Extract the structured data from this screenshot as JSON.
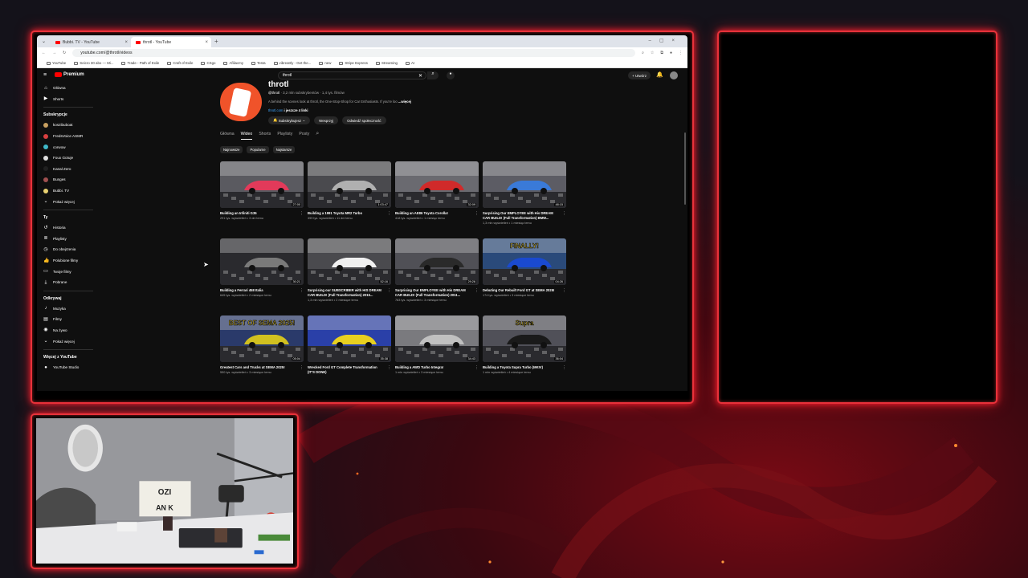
{
  "browser": {
    "tabs": [
      {
        "label": "Bubbi. TV - YouTube",
        "active": false
      },
      {
        "label": "throtl - YouTube",
        "active": true
      }
    ],
    "url": "youtube.com/@throtl/videos",
    "bookmarks": [
      "YouTube",
      "Seicro 30 abo — Mi...",
      "Trade - Path of Exile",
      "Craft of Exile",
      "CSgo",
      "Afiliacmy",
      "Testa",
      "vibreatrly - Get the...",
      "new",
      "Stripe Express",
      "Streaming",
      "AI"
    ]
  },
  "youtube": {
    "logo_label": "Premium",
    "search_value": "throtl",
    "create_label": "Utwórz",
    "sidebar": {
      "main": [
        {
          "label": "Główna",
          "icon": "home-icon"
        },
        {
          "label": "Shorts",
          "icon": "shorts-icon"
        }
      ],
      "subs_title": "Subskrypcje",
      "subs": [
        {
          "label": "koszibuboat",
          "color": "#c8a060"
        },
        {
          "label": "FredsVoice ASMR",
          "color": "#d94040"
        },
        {
          "label": "corwow",
          "color": "#3fb8c8"
        },
        {
          "label": "Foux Gotuje",
          "color": "#e0e0e0"
        },
        {
          "label": "Kanał Zero",
          "color": "#202020"
        },
        {
          "label": "Bunges",
          "color": "#a05050"
        },
        {
          "label": "Bubbi. TV",
          "color": "#e8d070"
        }
      ],
      "show_more": "Pokaż więcej",
      "you_title": "Ty",
      "you": [
        {
          "label": "Historia",
          "icon": "history-icon"
        },
        {
          "label": "Playlisty",
          "icon": "playlist-icon"
        },
        {
          "label": "Do obejrzenia",
          "icon": "watch-later-icon"
        },
        {
          "label": "Polubione filmy",
          "icon": "like-icon"
        },
        {
          "label": "Twoje filmy",
          "icon": "video-icon"
        },
        {
          "label": "Pobrane",
          "icon": "download-icon"
        }
      ],
      "explore_title": "Odkrywaj",
      "explore": [
        {
          "label": "Muzyka",
          "icon": "music-icon"
        },
        {
          "label": "Filmy",
          "icon": "movies-icon"
        },
        {
          "label": "Na żywo",
          "icon": "live-icon"
        },
        {
          "label": "Pokaż więcej",
          "icon": "chevron-down-icon"
        }
      ],
      "more_title": "Więcej z YouTube",
      "more": [
        {
          "label": "YouTube Studio",
          "icon": "studio-icon"
        }
      ]
    },
    "channel": {
      "name": "throtl",
      "handle": "@throtl",
      "meta": " · 3,2 mln subskrybentów · 1,4 tys. filmów",
      "desc": "A behind the scenes look at throtl, the One-Stop-Shop for Car Enthusiasts. If you're loo",
      "desc_more": "...więcej",
      "link": "throtl.com",
      "link_more": " i jeszcze 4 linki",
      "buttons": [
        "Subskrybujesz",
        "Wesprzyj",
        "Odwiedź społeczność"
      ],
      "tabs": [
        "Główna",
        "Wideo",
        "Shorts",
        "Playlisty",
        "Posty"
      ],
      "active_tab": "Wideo",
      "chips": [
        "Najnowsze",
        "Popularne",
        "Najstarsze"
      ]
    },
    "videos": [
      {
        "title": "Building an Infiniti G35",
        "meta": "291 tys. wyświetleń • 3 dni temu",
        "duration": "27:00",
        "bg": "#5a5a60",
        "car": "#e23a5a"
      },
      {
        "title": "Building a 1991 Toyota MR2 Turbo",
        "meta": "399 tys. wyświetleń • 11 dni temu",
        "duration": "1:03:47",
        "bg": "#4a4a4e",
        "car": "#b0b0b0"
      },
      {
        "title": "Building an AE86 Toyota Corolla!",
        "meta": "418 tys. wyświetleń • 1 miesiąc temu",
        "duration": "32:09",
        "bg": "#6a6a70",
        "car": "#d02a2a"
      },
      {
        "title": "Surprising Our EMPLOYEE with His DREAM CAR BUILD! (Full Transformation) BMW...",
        "meta": "1,3 mln wyświetleń • 1 miesiąc temu",
        "duration": "48:15",
        "bg": "#5c5c64",
        "car": "#3a7ad8"
      },
      {
        "title": "Building a Ferrari 458 Italia",
        "meta": "645 tys. wyświetleń • 2 miesiące temu",
        "duration": "30:21",
        "bg": "#2a2a2e",
        "car": "#7a7a7a"
      },
      {
        "title": "Surprising our SUBSCRIBER with HIS DREAM CAR BUILD! (Full Transformation) 2015...",
        "meta": "1,3 mln wyświetleń • 2 miesiące temu",
        "duration": "52:16",
        "bg": "#4a4a4e",
        "car": "#f0f0f0"
      },
      {
        "title": "Surprising Our EMPLOYEE with His DREAM CAR BUILD! (Full Transformation) 2011...",
        "meta": "783 tys. wyświetleń • 3 miesiące temu",
        "duration": "29:26",
        "bg": "#505056",
        "car": "#2a2a2a"
      },
      {
        "title": "Debuting Our Rebuilt Ford GT at SEMA 2025!",
        "meta": "174 tys. wyświetleń • 3 miesiące temu",
        "duration": "04:26",
        "bg": "#2a4a7a",
        "car": "#1a4ad0",
        "banner": "FINALLY!"
      },
      {
        "title": "Greatest Cars and Trucks at SEMA 2025!",
        "meta": "550 tys. wyświetleń • 3 miesiące temu",
        "duration": "05:04",
        "bg": "#2a3a6a",
        "car": "#d0c020",
        "banner": "BEST OF SEMA 2025!"
      },
      {
        "title": "Wrecked Ford GT Complete Transformation (IT'S DONE)",
        "meta": "",
        "duration": "35:38",
        "bg": "#2a40a8",
        "car": "#e8d020"
      },
      {
        "title": "Building a AWD Turbo Integra!",
        "meta": "1 mln wyświetleń • 3 miesiące temu",
        "duration": "34:43",
        "bg": "#7a7a7e",
        "car": "#c0c0c0"
      },
      {
        "title": "Building a Toyota Supra Turbo (MKIV)",
        "meta": "1 mln wyświetleń • 4 miesiące temu",
        "duration": "36:04",
        "bg": "#505058",
        "car": "#1a1a1a",
        "banner": "Supra"
      }
    ]
  },
  "webcam": {
    "sign_text": "OZI\nAN  K"
  },
  "theme": {
    "frame": "#e8323a",
    "bg": "#14121a"
  }
}
